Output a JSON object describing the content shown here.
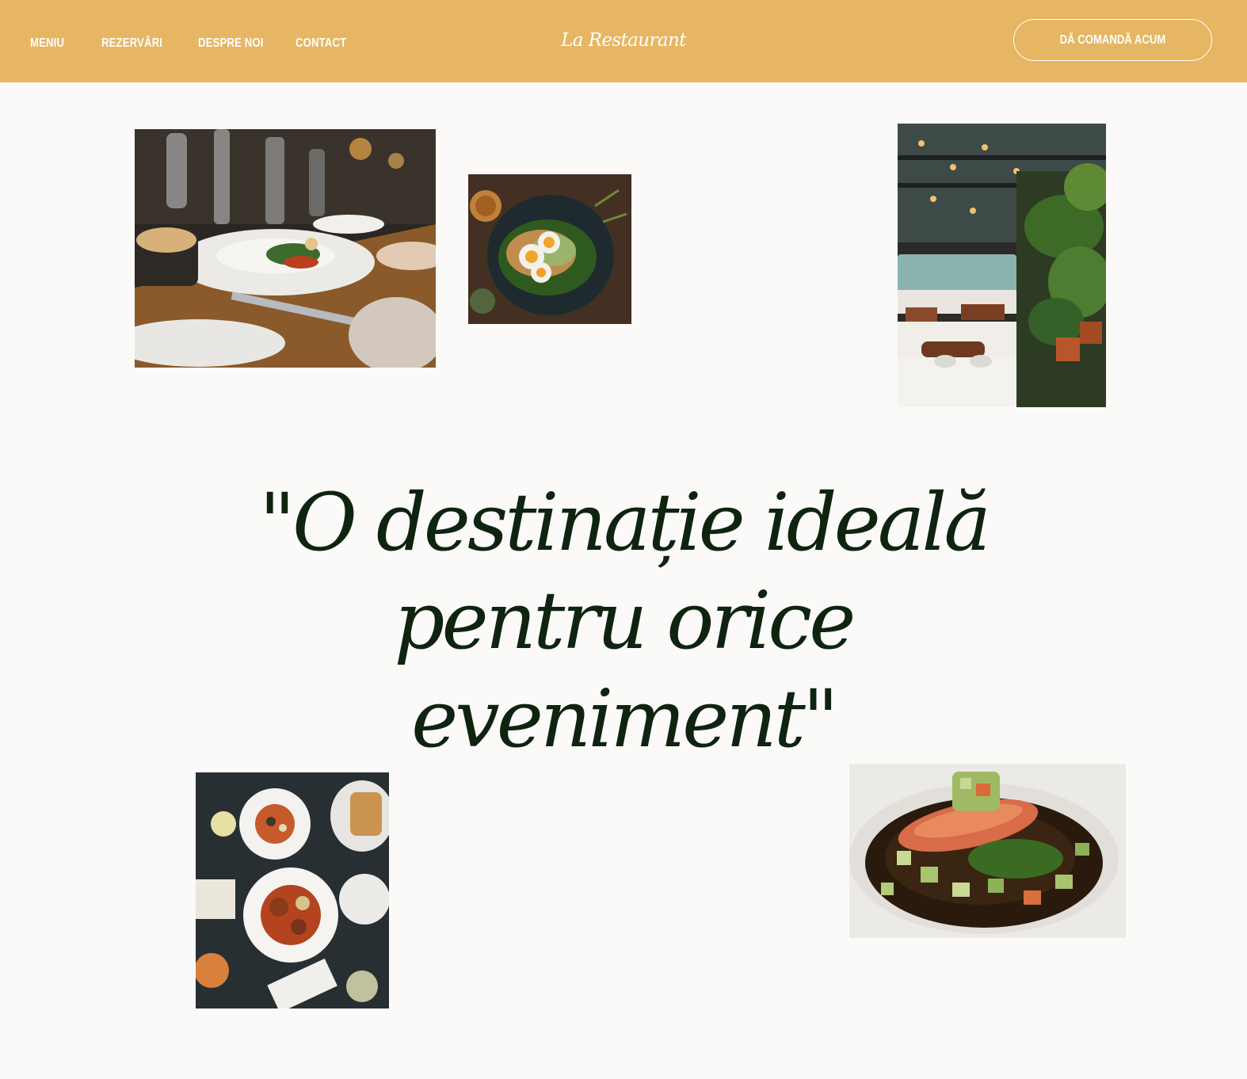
{
  "header": {
    "nav": [
      "MENIU",
      "REZERVĂRI",
      "DESPRE NOI",
      "CONTACT"
    ],
    "logo": "La Restaurant",
    "cta_label": "DĂ COMANDĂ ACUM"
  },
  "hero": {
    "quote_line1": "\"O destinație ideală",
    "quote_line2": "pentru orice",
    "quote_line3": "eveniment\""
  },
  "photos": [
    {
      "subject": "plated dish being served at a table"
    },
    {
      "subject": "avocado toast with boiled eggs"
    },
    {
      "subject": "restaurant interior with plants"
    },
    {
      "subject": "overhead view of table with several dishes"
    },
    {
      "subject": "salmon fillet with vegetables"
    }
  ],
  "colors": {
    "header_bg": "#e6b662",
    "page_bg": "#fcfaf8",
    "headline": "#0f2410",
    "nav_text": "#ffffff"
  }
}
